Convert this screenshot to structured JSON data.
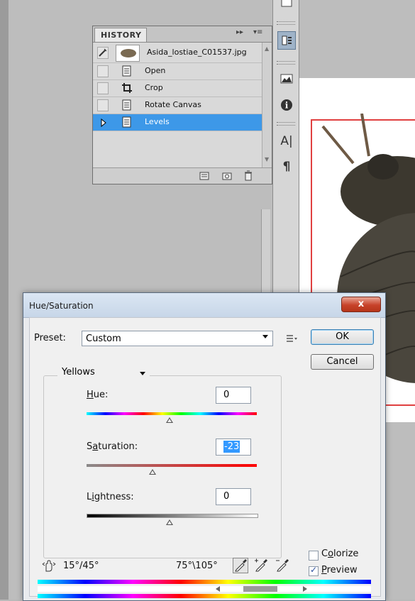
{
  "history": {
    "tab_label": "HISTORY",
    "snapshot_name": "Asida_lostiae_C01537.jpg",
    "collapse_glyph": "▸▸",
    "menu_glyph": "▾≡",
    "items": [
      {
        "label": "Open",
        "icon": "document-icon"
      },
      {
        "label": "Crop",
        "icon": "crop-icon"
      },
      {
        "label": "Rotate Canvas",
        "icon": "document-icon"
      },
      {
        "label": "Levels",
        "icon": "document-icon",
        "selected": true
      }
    ]
  },
  "dock": {
    "icons": [
      "navigator-icon",
      "history-icon",
      "histogram-icon",
      "info-icon",
      "character-icon",
      "paragraph-icon"
    ],
    "character_glyph": "A|",
    "paragraph_glyph": "¶"
  },
  "dialog": {
    "title": "Hue/Saturation",
    "close_label": "x",
    "preset_label": "Preset:",
    "preset_value": "Custom",
    "ok_label": "OK",
    "cancel_label": "Cancel",
    "channel_value": "Yellows",
    "hue_label": "Hue:",
    "hue_value": "0",
    "saturation_label": "Saturation:",
    "saturation_value": "-23",
    "lightness_label": "Lightness:",
    "lightness_value": "0",
    "range_left": "15°/45°",
    "range_right": "75°\\105°",
    "colorize_label": "Colorize",
    "colorize_checked": false,
    "preview_label": "Preview",
    "preview_checked": true
  },
  "colors": {
    "selection_blue": "#3d98e8",
    "doc_border_red": "#e04040"
  }
}
